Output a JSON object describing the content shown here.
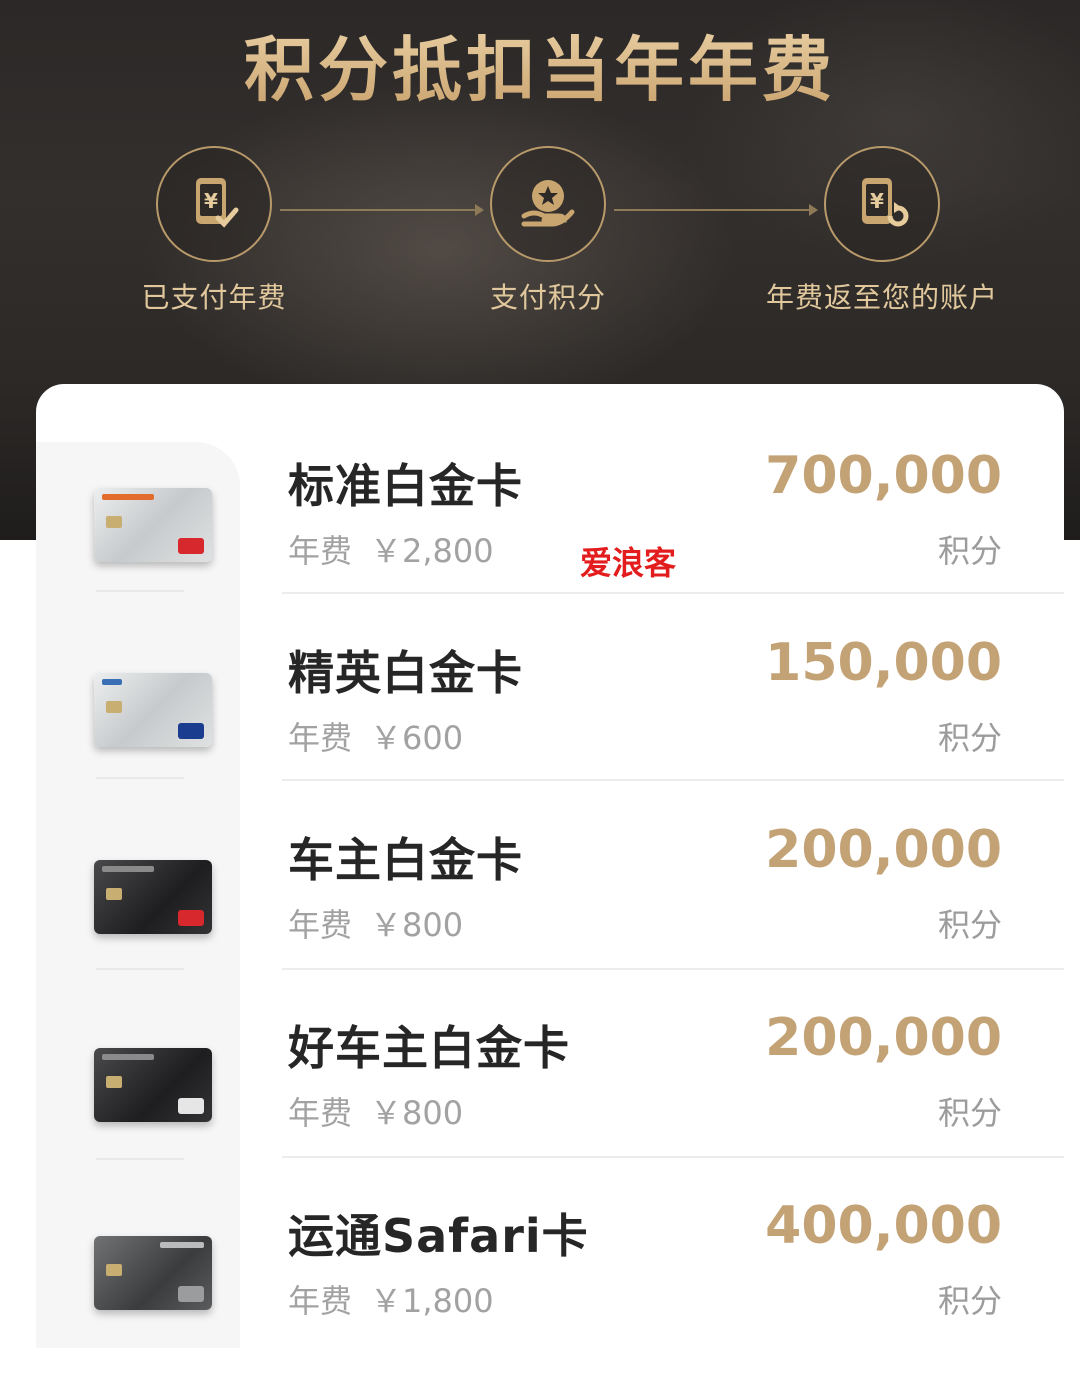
{
  "hero": {
    "title": "积分抵扣当年年费",
    "steps": [
      {
        "label": "已支付年费",
        "icon": "phone-yen-check-icon"
      },
      {
        "label": "支付积分",
        "icon": "hand-star-coin-icon"
      },
      {
        "label": "年费返至您的账户",
        "icon": "phone-yen-return-icon"
      }
    ]
  },
  "watermark": "爱浪客",
  "fee_prefix": "年费",
  "points_unit": "积分",
  "cards": [
    {
      "name": "标准白金卡",
      "fee": "￥2,800",
      "points": "700,000",
      "style": "silver"
    },
    {
      "name": "精英白金卡",
      "fee": "￥600",
      "points": "150,000",
      "style": "silver"
    },
    {
      "name": "车主白金卡",
      "fee": "￥800",
      "points": "200,000",
      "style": "dark"
    },
    {
      "name": "好车主白金卡",
      "fee": "￥800",
      "points": "200,000",
      "style": "dark"
    },
    {
      "name": "运通Safari卡",
      "fee": "￥1,800",
      "points": "400,000",
      "style": "amex"
    }
  ],
  "colors": {
    "gold": "#c3a376",
    "hero_text": "#e0c79c",
    "watermark": "#e31d1d"
  }
}
